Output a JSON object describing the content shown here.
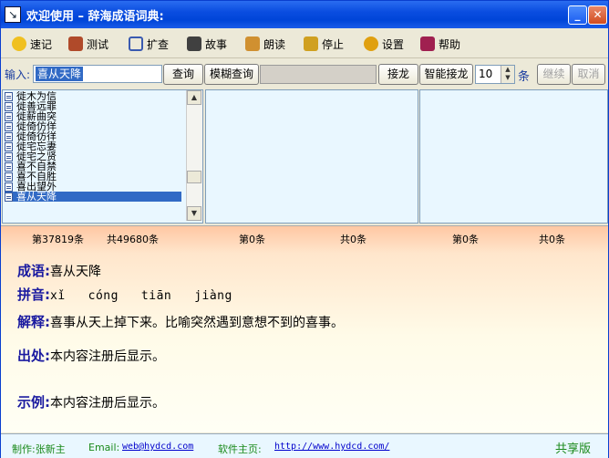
{
  "window": {
    "title": "欢迎使用 – 辞海成语词典:"
  },
  "toolbar": {
    "items": [
      {
        "label": "速记",
        "icon": "smiley-icon",
        "color": "#f0c020"
      },
      {
        "label": "测试",
        "icon": "tank-icon",
        "color": "#b04a2a"
      },
      {
        "label": "扩查",
        "icon": "ruler-icon",
        "color": "#3a5ab0"
      },
      {
        "label": "故事",
        "icon": "book-icon",
        "color": "#404040"
      },
      {
        "label": "朗读",
        "icon": "speaker-icon",
        "color": "#d09030"
      },
      {
        "label": "停止",
        "icon": "stop-icon",
        "color": "#d0a020"
      },
      {
        "label": "设置",
        "icon": "gear-icon",
        "color": "#e0a010"
      },
      {
        "label": "帮助",
        "icon": "help-book-icon",
        "color": "#a02050"
      }
    ]
  },
  "input": {
    "label": "输入:",
    "value": "喜从天降",
    "query_button": "查询",
    "fuzzy_button": "模糊查询",
    "chain_button": "接龙",
    "smart_chain_button": "智能接龙",
    "count_value": "10",
    "count_unit": "条",
    "continue_button": "继续",
    "cancel_button": "取消"
  },
  "list": {
    "items": [
      "徙木为信",
      "徙善远罪",
      "徙薪曲突",
      "徙倚仿佯",
      "徙倚彷徉",
      "徙宅忘妻",
      "徙宅之贤",
      "喜不自禁",
      "喜不自胜",
      "喜出望外",
      "喜从天降"
    ],
    "selected_index": 10
  },
  "counts": {
    "current": "第37819条",
    "total": "共49680条",
    "p2_current": "第0条",
    "p2_total": "共0条",
    "p3_current": "第0条",
    "p3_total": "共0条"
  },
  "detail": {
    "idiom_label": "成语:",
    "idiom": "喜从天降",
    "pinyin_label": "拼音:",
    "pinyin": "xǐ   cóng   tiān   jiàng",
    "meaning_label": "解释:",
    "meaning": "喜事从天上掉下来。比喻突然遇到意想不到的喜事。",
    "source_label": "出处:",
    "source": "本内容注册后显示。",
    "example_label": "示例:",
    "example": "本内容注册后显示。"
  },
  "status": {
    "author": "制作:张新主",
    "email_label": "Email:",
    "email": "web@hydcd.com",
    "home_label": "软件主页:",
    "home": "http://www.hydcd.com/",
    "edition": "共享版"
  }
}
